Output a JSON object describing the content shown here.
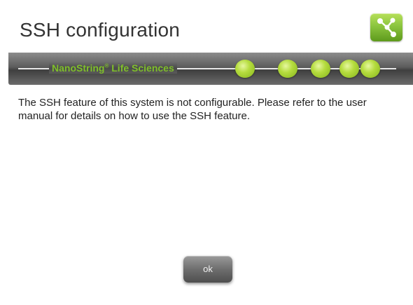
{
  "dialog": {
    "title": "SSH configuration",
    "icon": "network-nodes-icon",
    "message": "The SSH feature of this system is not configurable.  Please refer to the user manual for details on how to use the SSH feature.",
    "ok_label": "ok"
  },
  "brand": {
    "name": "NanoString",
    "mark": "®",
    "suffix": " Life Sciences",
    "accent_color": "#8bc53f"
  }
}
